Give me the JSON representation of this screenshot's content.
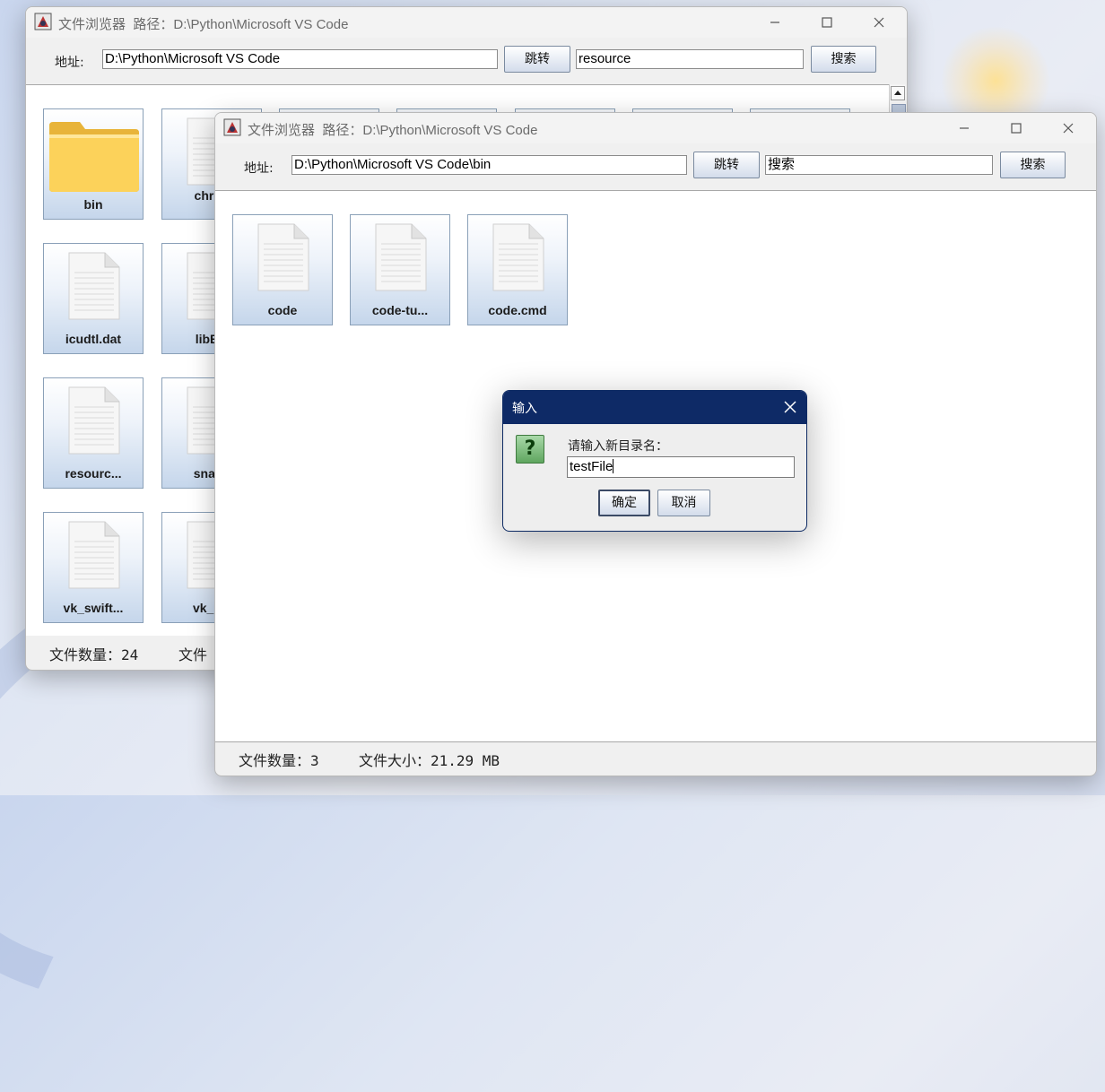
{
  "back_window": {
    "title": "文件浏览器",
    "path_label": "路径：",
    "path_value": "D:\\Python\\Microsoft VS Code",
    "address_label": "地址:",
    "address_value": "D:\\Python\\Microsoft VS Code",
    "go_button": "跳转",
    "search_value": "resource",
    "search_button": "搜索",
    "files": [
      "bin",
      "chron",
      "icudtl.dat",
      "libEG",
      "resourc...",
      "snaps",
      "vk_swift...",
      "vk_sw"
    ],
    "status": {
      "count_text": "文件数量：24",
      "size_text": "文件"
    }
  },
  "front_window": {
    "title": "文件浏览器",
    "path_label": "路径：",
    "path_value": "D:\\Python\\Microsoft VS Code",
    "address_label": "地址:",
    "address_value": "D:\\Python\\Microsoft VS Code\\bin",
    "go_button": "跳转",
    "search_value": "搜索",
    "search_button": "搜索",
    "files": [
      "code",
      "code-tu...",
      "code.cmd"
    ],
    "status": {
      "count_text": "文件数量：3",
      "size_text": "文件大小：21.29 MB"
    }
  },
  "dialog": {
    "title": "输入",
    "prompt": "请输入新目录名：",
    "input_value": "testFile",
    "ok_button": "确定",
    "cancel_button": "取消"
  },
  "colors": {
    "dialog_title_bar": "#0e2a66",
    "folder": "#f9cc4e",
    "button_gradient_bottom": "#d3dceb"
  }
}
